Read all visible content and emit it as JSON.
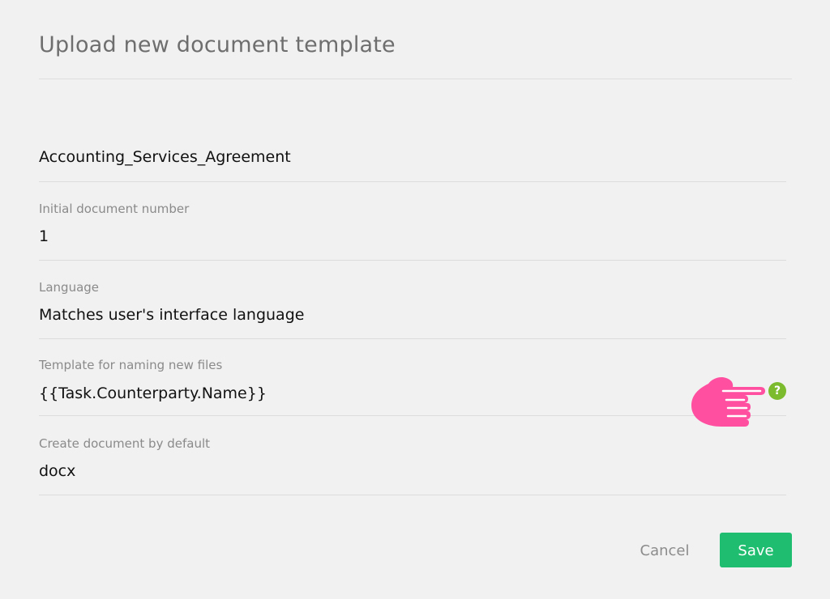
{
  "dialog": {
    "title": "Upload new document template"
  },
  "fields": {
    "template_name": {
      "value": "Accounting_Services_Agreement"
    },
    "initial_number": {
      "label": "Initial document number",
      "value": "1"
    },
    "language": {
      "label": "Language",
      "value": "Matches user's interface language"
    },
    "file_naming_template": {
      "label": "Template for naming new files",
      "value": "{{Task.Counterparty.Name}}",
      "help_icon": "question-icon",
      "help_glyph": "?"
    },
    "default_format": {
      "label": "Create document by default",
      "value": "docx"
    }
  },
  "actions": {
    "cancel_label": "Cancel",
    "save_label": "Save"
  },
  "colors": {
    "background": "#f1f1f1",
    "accent_save": "#1fbd6f",
    "help_icon": "#7dbb2e",
    "pointer_hand": "#ff4fa0"
  }
}
